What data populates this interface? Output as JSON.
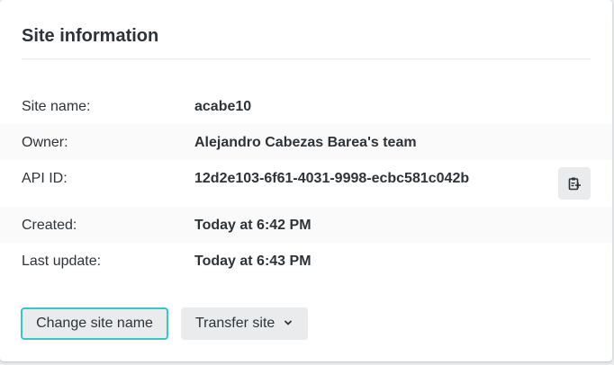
{
  "card": {
    "title": "Site information"
  },
  "info": {
    "rows": [
      {
        "label": "Site name:",
        "value": "acabe10"
      },
      {
        "label": "Owner:",
        "value": "Alejandro Cabezas Barea's team"
      },
      {
        "label": "API ID:",
        "value": "12d2e103-6f61-4031-9998-ecbc581c042b"
      },
      {
        "label": "Created:",
        "value": "Today at 6:42 PM"
      },
      {
        "label": "Last update:",
        "value": "Today at 6:43 PM"
      }
    ],
    "copy_icon": "clipboard-copy-icon"
  },
  "actions": {
    "change_label": "Change site name",
    "transfer_label": "Transfer site",
    "transfer_icon": "chevron-down-icon"
  },
  "colors": {
    "focus_ring": "#30c8c9",
    "button_bg": "#e9ebed",
    "text": "#2e3338",
    "stripe": "#fafafa"
  }
}
